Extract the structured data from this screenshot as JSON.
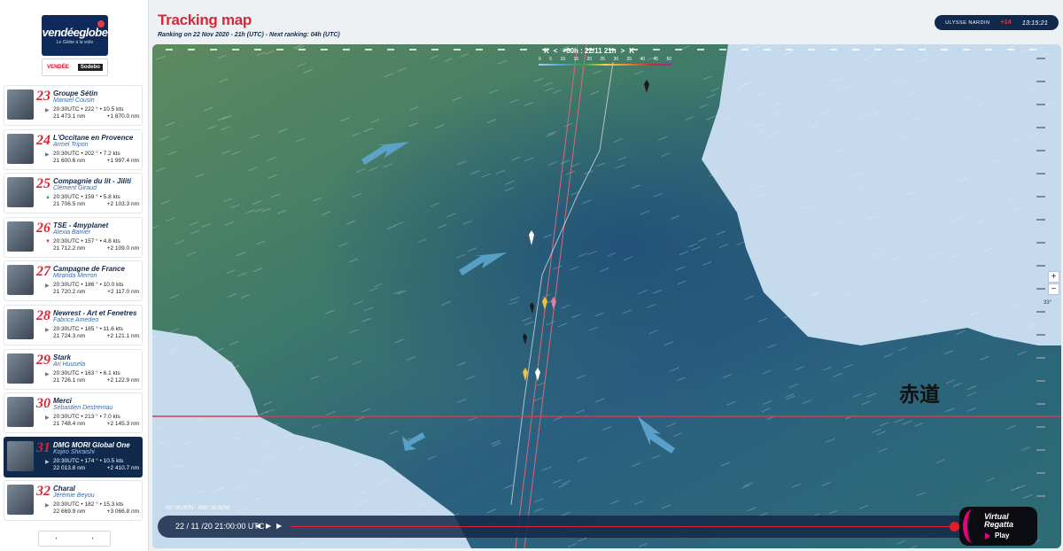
{
  "header": {
    "title": "Tracking map",
    "subtitle": "Ranking on 22 Nov 2020 - 21h (UTC)  -  Next ranking: 04h (UTC)",
    "clock": {
      "brand": "ULYSSE NARDIN",
      "offset": "+14",
      "time": "13:15:21"
    }
  },
  "logo": {
    "main": "vendéeglobe",
    "sub": "Le Globe à la voile"
  },
  "partners": {
    "vendee": "VENDÉE",
    "sodebo": "Sodebo"
  },
  "skippers": [
    {
      "rank": "23",
      "boat": "Groupe Sétin",
      "skipper": "Manuel Cousin",
      "trend": "steady",
      "speed": "20:30UTC • 222 ° • 10.5 kts",
      "dist": "21 473.1 nm",
      "gap": "+1 870.0 nm"
    },
    {
      "rank": "24",
      "boat": "L'Occitane en Provence",
      "skipper": "Armel Tripon",
      "trend": "steady",
      "speed": "20:30UTC • 202 ° • 7.2 kts",
      "dist": "21 600.6 nm",
      "gap": "+1 997.4 nm"
    },
    {
      "rank": "25",
      "boat": "Compagnie du lit - Jiliti",
      "skipper": "Clément Giraud",
      "trend": "up",
      "speed": "20:30UTC • 159 ° • 5.8 kts",
      "dist": "21 706.5 nm",
      "gap": "+2 103.3 nm"
    },
    {
      "rank": "26",
      "boat": "TSE - 4myplanet",
      "skipper": "Alexia Barrier",
      "trend": "down",
      "speed": "20:30UTC • 157 ° • 4.8 kts",
      "dist": "21 712.2 nm",
      "gap": "+2 109.0 nm"
    },
    {
      "rank": "27",
      "boat": "Campagne de France",
      "skipper": "Miranda Merron",
      "trend": "steady",
      "speed": "20:30UTC • 186 ° • 10.0 kts",
      "dist": "21 720.2 nm",
      "gap": "+2 117.0 nm"
    },
    {
      "rank": "28",
      "boat": "Newrest - Art et Fenetres",
      "skipper": "Fabrice Amedeo",
      "trend": "steady",
      "speed": "20:30UTC • 185 ° • 11.6 kts",
      "dist": "21 724.3 nm",
      "gap": "+2 121.1 nm"
    },
    {
      "rank": "29",
      "boat": "Stark",
      "skipper": "Ari Huusela",
      "trend": "steady",
      "speed": "20:30UTC • 163 ° • 6.1 kts",
      "dist": "21 726.1 nm",
      "gap": "+2 122.9 nm"
    },
    {
      "rank": "30",
      "boat": "Merci",
      "skipper": "Sébastien Destremau",
      "trend": "steady",
      "speed": "20:30UTC • 213 ° • 7.0 kts",
      "dist": "21 748.4 nm",
      "gap": "+2 145.3 nm"
    },
    {
      "rank": "31",
      "boat": "DMG MORI Global One",
      "skipper": "Kojiro Shiraishi",
      "trend": "steady",
      "speed": "20:30UTC • 174 ° • 10.5 kts",
      "dist": "22 013.8 nm",
      "gap": "+2 410.7 nm"
    },
    {
      "rank": "32",
      "boat": "Charal",
      "skipper": "Jérémie Beyou",
      "trend": "steady",
      "speed": "20:30UTC • 182 ° • 15.3 kts",
      "dist": "22 669.9 nm",
      "gap": "+3 066.8 nm"
    }
  ],
  "map": {
    "time_nav": {
      "first": "K",
      "prev": "<",
      "label": "+00h : 22/11 21h",
      "next": ">",
      "last": "K"
    },
    "wind_scale": [
      "0",
      "5",
      "10",
      "15",
      "20",
      "25",
      "30",
      "35",
      "40",
      "45",
      "50"
    ],
    "equator_label": "赤道",
    "lat_label": "33°",
    "coord_readout": "00° 00.00'N - 000° 00.00'W",
    "zoom_in": "+",
    "zoom_out": "−",
    "timeline": {
      "date": "22 / 11 /20  21:00:00 UTC",
      "progress": 1.0
    }
  },
  "virtual_regatta": {
    "line1": "Virtual",
    "line2": "Regatta",
    "line3": "Play"
  },
  "colors": {
    "accent": "#d62839",
    "navy": "#0f2a4d",
    "sea": "#2a6e8a",
    "land": "#c5daed"
  }
}
